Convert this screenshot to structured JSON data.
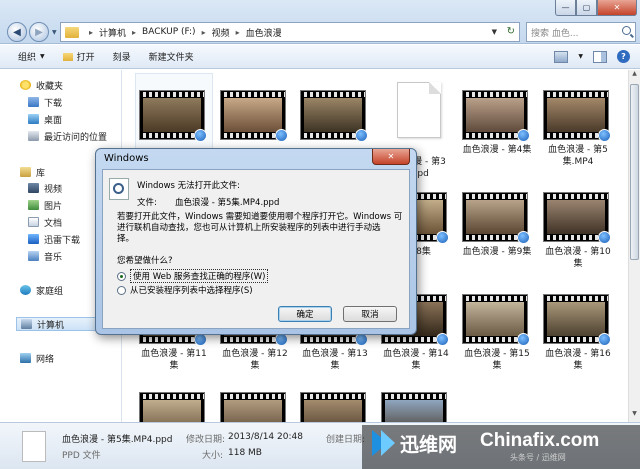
{
  "window": {
    "min_glyph": "—",
    "max_glyph": "▢",
    "close_glyph": "✕"
  },
  "address": {
    "crumbs": [
      "计算机",
      "BACKUP (F:)",
      "视频",
      "血色浪漫"
    ],
    "sep": "▸",
    "search_placeholder": "搜索 血色...",
    "back_glyph": "◀",
    "fwd_glyph": "▶"
  },
  "toolbar": {
    "organize": "组织",
    "open": "打开",
    "burn": "刻录",
    "new_folder": "新建文件夹",
    "help": "?"
  },
  "sidebar": {
    "favorites": "收藏夹",
    "downloads": "下载",
    "desktop": "桌面",
    "recent": "最近访问的位置",
    "libraries": "库",
    "videos": "视频",
    "pictures": "图片",
    "documents": "文档",
    "thunder": "迅雷下载",
    "music": "音乐",
    "homegroup": "家庭组",
    "computer": "计算机",
    "network": "网络"
  },
  "tiles": {
    "row2": [
      {
        "line1": "血色浪漫 - 第3",
        "line2": "4.ppd"
      },
      {
        "line1": "血色浪漫 - 第4集",
        "line2": ""
      },
      {
        "line1": "血色浪漫 - 第5",
        "line2": "集.MP4"
      }
    ],
    "row3": [
      {
        "line1": "- 第8集",
        "line2": ""
      },
      {
        "line1": "血色浪漫 - 第9集",
        "line2": ""
      },
      {
        "line1": "血色浪漫 - 第10",
        "line2": "集"
      }
    ],
    "row4": [
      {
        "line1": "血色浪漫 - 第11",
        "line2": "集"
      },
      {
        "line1": "血色浪漫 - 第12",
        "line2": "集"
      },
      {
        "line1": "血色浪漫 - 第13",
        "line2": "集"
      },
      {
        "line1": "血色浪漫 - 第14",
        "line2": "集"
      },
      {
        "line1": "血色浪漫 - 第15",
        "line2": "集"
      },
      {
        "line1": "血色浪漫 - 第16",
        "line2": "集"
      }
    ]
  },
  "dialog": {
    "title": "Windows",
    "heading": "Windows 无法打开此文件:",
    "file_label": "文件:",
    "file_name": "血色浪漫 - 第5集.MP4.ppd",
    "para1": "若要打开此文件，Windows 需要知道要使用哪个程序打开它。Windows 可",
    "para2": "进行联机自动查找，您也可从计算机上所安装程序的列表中进行手动选",
    "para3": "择。",
    "question": "您希望做什么?",
    "option1": "使用 Web 服务查找正确的程序(W)",
    "option2": "从已安装程序列表中选择程序(S)",
    "ok": "确定",
    "cancel": "取消",
    "close_glyph": "✕"
  },
  "details": {
    "file_name": "血色浪漫 - 第5集.MP4.ppd",
    "type": "PPD 文件",
    "modified_label": "修改日期:",
    "modified": "2013/8/14 20:48",
    "size_label": "大小:",
    "size": "118 MB",
    "created_label": "创建日期:",
    "created": "2013/8/14 20:46"
  },
  "watermark": {
    "brand_cn": "迅维网",
    "brand_en": "Chinafix.com",
    "sub": "头条号 / 迅维网"
  },
  "colors": {
    "accent": "#3c7fb1",
    "close_red": "#c5432a"
  }
}
